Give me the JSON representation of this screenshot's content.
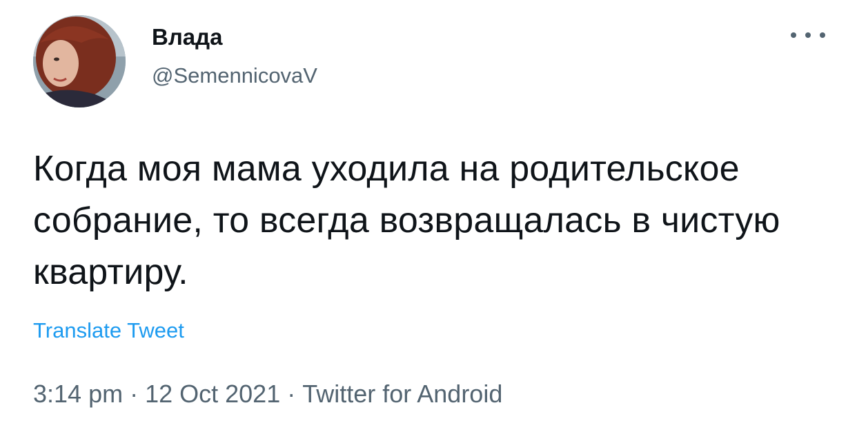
{
  "author": {
    "display_name": "Влада",
    "handle": "@SemennicovaV",
    "avatar_icon": "profile-photo"
  },
  "actions": {
    "more_icon": "more-horizontal-icon"
  },
  "tweet": {
    "text": "Когда моя мама уходила на родительское собрание, то всегда возвращалась в чистую квартиру.",
    "translate_label": "Translate Tweet"
  },
  "meta": {
    "time": "3:14 pm",
    "separator": "·",
    "date": "12 Oct 2021",
    "source": "Twitter for Android"
  },
  "colors": {
    "text_primary": "#0f1419",
    "text_secondary": "#536471",
    "link": "#1d9bf0",
    "background": "#ffffff"
  }
}
